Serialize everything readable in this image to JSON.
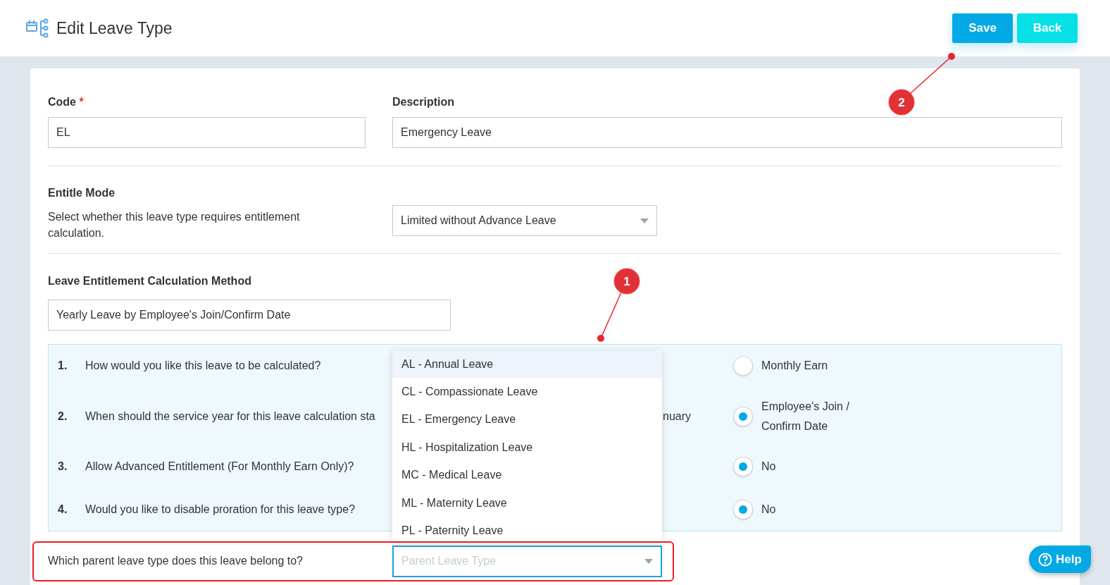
{
  "header": {
    "title": "Edit Leave Type",
    "buttons": [
      {
        "kind": "primary",
        "label": "Save"
      },
      {
        "kind": "secondary",
        "label": "Back"
      }
    ]
  },
  "code": {
    "label": "Code",
    "required_mark": "*",
    "value": "EL"
  },
  "description": {
    "label": "Description",
    "value": "Emergency Leave"
  },
  "entitle_mode": {
    "label": "Entitle Mode",
    "hint": "Select whether this leave type requires entitlement calculation.",
    "value": "Limited without Advance Leave"
  },
  "calculation_method": {
    "label": "Leave Entitlement Calculation Method",
    "value": "Yearly Leave by Employee's Join/Confirm Date"
  },
  "questions": [
    {
      "number": "1.",
      "text": "How would you like this leave to be calculated?",
      "option": {
        "label": "Monthly Earn",
        "selected": false
      }
    },
    {
      "number": "2.",
      "text": "When should the service year for this leave calculation sta",
      "column_3": "nuary",
      "option": {
        "label": "Employee's Join / Confirm Date",
        "selected": true
      }
    },
    {
      "number": "3.",
      "text": "Allow Advanced Entitlement (For Monthly Earn Only)?",
      "option": {
        "label": "No",
        "selected": true
      }
    },
    {
      "number": "4.",
      "text": "Would you like to disable proration for this leave type?",
      "option": {
        "label": "No",
        "selected": true
      }
    }
  ],
  "parent_leave": {
    "label": "Which parent leave type does this leave belong to?",
    "placeholder": "Parent Leave Type",
    "options": [
      {
        "label": "AL - Annual Leave",
        "selected": true
      },
      {
        "label": "CL - Compassionate Leave",
        "selected": false
      },
      {
        "label": "EL - Emergency Leave",
        "selected": false
      },
      {
        "label": "HL - Hospitalization Leave",
        "selected": false
      },
      {
        "label": "MC - Medical Leave",
        "selected": false
      },
      {
        "label": "ML - Maternity Leave",
        "selected": false
      },
      {
        "label": "PL - Paternity Leave",
        "selected": false
      }
    ]
  },
  "annotations": [
    {
      "label": "1"
    },
    {
      "label": "2"
    }
  ],
  "help": {
    "label": "Help"
  }
}
